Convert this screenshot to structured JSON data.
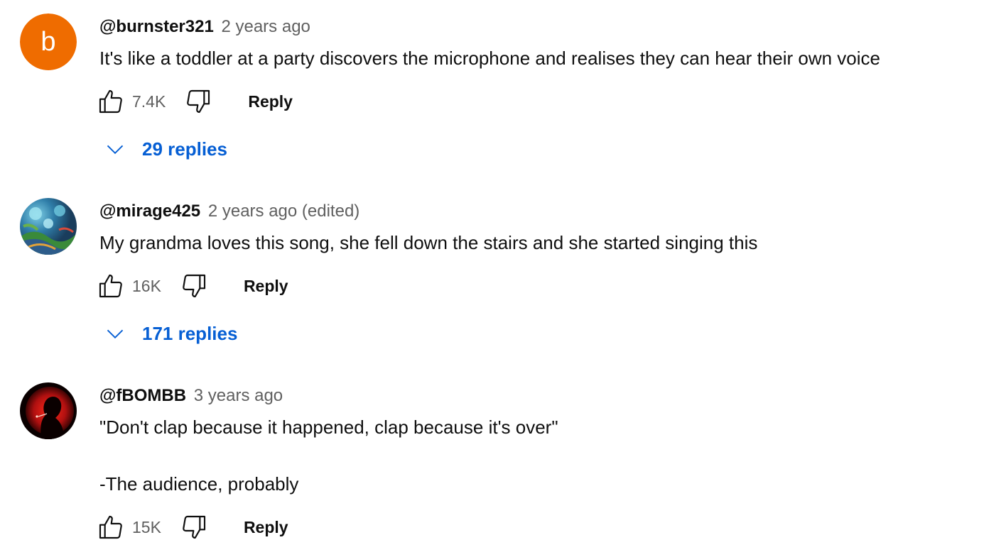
{
  "comments": [
    {
      "author": "@burnster321",
      "time": "2 years ago",
      "text": "It's like a toddler at a party discovers the microphone and realises they can hear their own voice",
      "likes": "7.4K",
      "reply_label": "Reply",
      "replies_label": "29 replies",
      "avatar": {
        "type": "letter",
        "letter": "b",
        "color": "#ef6c00"
      }
    },
    {
      "author": "@mirage425",
      "time": "2 years ago (edited)",
      "text": "My grandma loves this song, she fell down the stairs and she started singing this",
      "likes": "16K",
      "reply_label": "Reply",
      "replies_label": "171 replies",
      "avatar": {
        "type": "image",
        "description_icon": "painting-avatar-icon"
      }
    },
    {
      "author": "@fBOMBB",
      "time": "3 years ago",
      "text": "\"Don't clap because it happened, clap because it's over\"\n\n-The audience, probably",
      "likes": "15K",
      "reply_label": "Reply",
      "avatar": {
        "type": "image",
        "description_icon": "red-silhouette-avatar-icon"
      }
    }
  ],
  "colors": {
    "link_blue": "#065fd4",
    "meta_gray": "#606060",
    "text": "#0f0f0f"
  },
  "icons": {
    "like": "thumbs-up-icon",
    "dislike": "thumbs-down-icon",
    "expand": "chevron-down-icon"
  }
}
